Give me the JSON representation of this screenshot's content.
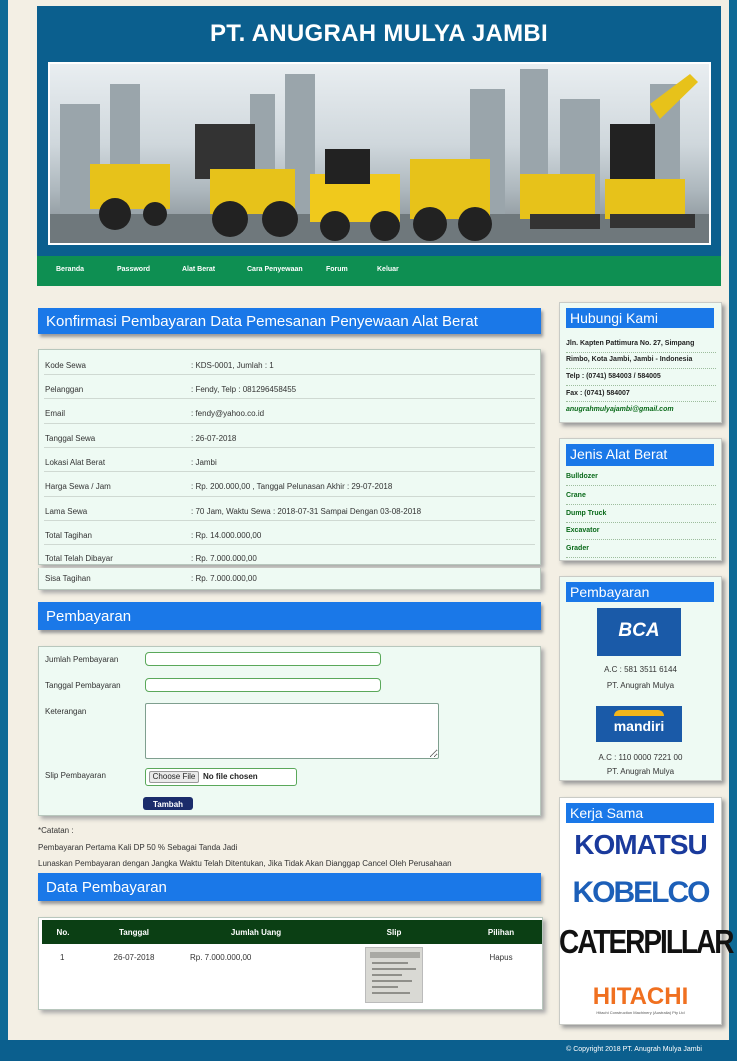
{
  "site": {
    "title": "PT. ANUGRAH MULYA JAMBI"
  },
  "nav": [
    "Beranda",
    "Password",
    "Alat Berat",
    "Cara Penyewaan",
    "Forum",
    "Keluar"
  ],
  "confirm": {
    "title": "Konfirmasi Pembayaran Data Pemesanan Penyewaan Alat Berat",
    "rows": [
      {
        "label": "Kode Sewa",
        "value": ": KDS-0001, Jumlah : 1"
      },
      {
        "label": "Pelanggan",
        "value": ": Fendy, Telp : 081296458455"
      },
      {
        "label": "Email",
        "value": ": fendy@yahoo.co.id"
      },
      {
        "label": "Tanggal Sewa",
        "value": ": 26-07-2018"
      },
      {
        "label": "Lokasi Alat Berat",
        "value": ": Jambi"
      },
      {
        "label": "Harga Sewa / Jam",
        "value": ": Rp. 200.000,00 , Tanggal Pelunasan Akhir : 29-07-2018"
      },
      {
        "label": "Lama Sewa",
        "value": ": 70 Jam, Waktu Sewa : 2018-07-31 Sampai Dengan 03-08-2018"
      },
      {
        "label": "Total Tagihan",
        "value": ": Rp. 14.000.000,00"
      },
      {
        "label": "Total Telah Dibayar",
        "value": ": Rp. 7.000.000,00"
      },
      {
        "label": "Sisa Tagihan",
        "value": ": Rp. 7.000.000,00"
      }
    ]
  },
  "payment_form": {
    "title": "Pembayaran",
    "jumlah_label": "Jumlah Pembayaran",
    "jumlah_value": "",
    "tanggal_label": "Tanggal Pembayaran",
    "tanggal_value": "",
    "keterangan_label": "Keterangan",
    "keterangan_value": "",
    "slip_label": "Slip Pembayaran",
    "choose_file": "Choose File",
    "no_file": "No file chosen",
    "submit": "Tambah"
  },
  "notes": [
    "*Catatan :",
    "Pembayaran Pertama Kali DP 50 % Sebagai Tanda Jadi",
    "Lunaskan Pembayaran dengan Jangka Waktu Telah Ditentukan, Jika Tidak Akan Dianggap Cancel Oleh Perusahaan"
  ],
  "payment_table": {
    "title": "Data Pembayaran",
    "headers": [
      "No.",
      "Tanggal",
      "Jumlah Uang",
      "Slip",
      "Pilihan"
    ],
    "rows": [
      {
        "no": "1",
        "tanggal": "26-07-2018",
        "jumlah": "Rp. 7.000.000,00",
        "pilihan": "Hapus"
      }
    ]
  },
  "sidebar": {
    "contact": {
      "title": "Hubungi Kami",
      "address1": "Jln. Kapten Pattimura No. 27, Simpang",
      "address2": "Rimbo, Kota Jambi, Jambi - Indonesia",
      "telp": "Telp : (0741) 584003 / 584005",
      "fax": "Fax : (0741) 584007",
      "email": "anugrahmulyajambi@gmail.com"
    },
    "categories": {
      "title": "Jenis Alat Berat",
      "items": [
        "Bulldozer",
        "Crane",
        "Dump Truck",
        "Excavator",
        "Grader"
      ]
    },
    "payment": {
      "title": "Pembayaran",
      "bca_logo": "BCA",
      "bca_account": "A.C : 581 3511 6144",
      "bca_name": "PT. Anugrah Mulya",
      "mandiri_logo": "mandiri",
      "mandiri_account": "A.C : 110 0000 7221 00",
      "mandiri_name": "PT. Anugrah Mulya"
    },
    "partners": {
      "title": "Kerja Sama",
      "komatsu": "KOMATSU",
      "kobelco": "KOBELCO",
      "caterpillar": "CATERPILLAR",
      "hitachi": "HITACHI",
      "hitachi_sub": "Hitachi Construction Machinery (Australia) Pty Ltd"
    }
  },
  "footer": {
    "copyright": "© Copyright 2018 PT. Anugrah Mulya Jambi"
  },
  "colors": {
    "header": "#0b5f8e",
    "nav": "#0e8f52",
    "panel_title": "#1a78e8",
    "table_head": "#0b3f14"
  }
}
